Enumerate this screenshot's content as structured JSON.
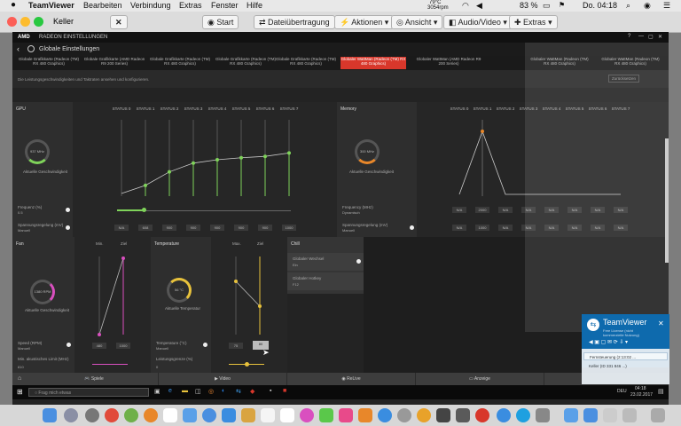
{
  "menubar": {
    "apple": "",
    "app": "TeamViewer",
    "items": [
      "Bearbeiten",
      "Verbindung",
      "Extras",
      "Fenster",
      "Hilfe"
    ],
    "temp": "79°C",
    "rpm": "3054rpm",
    "battery": "83 %",
    "clock": "Do. 04:18"
  },
  "tv": {
    "window_title": "Keller",
    "close": "✕",
    "buttons": [
      "Start",
      "Dateiübertragung",
      "Aktionen",
      "Ansicht",
      "Audio/Video",
      "Extras"
    ]
  },
  "amd": {
    "title": "RADEON EINSTELLUNGEN",
    "brand": "AMD",
    "back": "‹",
    "section": "Globale Einstellungen",
    "tabs": [
      "Globale Grafikkarte (Radeon (TM) RX 480 Graphics)",
      "Globale Grafikkarte (AMD Radeon R9 200 Series)",
      "Globale Grafikkarte (Radeon (TM) RX 480 Graphics)",
      "Globale Grafikkarte (Radeon (TM) RX 480 Graphics)",
      "Globale Grafikkarte (Radeon (TM) RX 480 Graphics)",
      "Globaler WattMan (Radeon (TM) RX 480 Graphics)",
      "Globaler WattMan (AMD Radeon R9 200 Series)",
      "Globaler WattMan (Radeon (TM) RX 480 Graphics)",
      "Globaler WattMan (Radeon (TM) RX 480 Graphics)"
    ],
    "description": "Die Leistungsgeschwindigkeiten und Taktraten ansehen und konfigurieren.",
    "reset_label": "Zurücksetzen",
    "gpu_label": "GPU",
    "memory_label": "Memory",
    "status_labels": [
      "STATUS 0",
      "STATUS 1",
      "STATUS 2",
      "STATUS 3",
      "STATUS 4",
      "STATUS 5",
      "STATUS 6",
      "STATUS 7"
    ],
    "gpu_gauge": "937 MHz",
    "gpu_gauge_caption": "Aktuelle Geschwindigkeit",
    "mem_gauge": "300 MHz",
    "mem_gauge_caption": "Aktuelle Geschwindigkeit",
    "freq_label": "Frequenz (%)",
    "freq_value": "0.5",
    "volt_label": "Spannungsregelung (mV)",
    "volt_mode": "Manuell",
    "gpu_cells": [
      "N/A",
      "608",
      "900",
      "900",
      "900",
      "900",
      "900",
      "1000"
    ],
    "mem_freq_label": "Frequency (MHz)",
    "mem_freq_mode": "Dynamisch",
    "mem_volt_label": "Spannungsregelung (mV)",
    "mem_volt_mode": "Manuell",
    "mem_cells1": [
      "N/A",
      "2000",
      "N/A",
      "N/A",
      "N/A",
      "N/A",
      "N/A",
      "N/A"
    ],
    "mem_cells2": [
      "N/A",
      "1000",
      "N/A",
      "N/A",
      "N/A",
      "N/A",
      "N/A",
      "N/A"
    ],
    "fan_label": "Fan",
    "fan_min": "Min.",
    "fan_ziel": "Ziel",
    "fan_gauge": "1380 RPM",
    "fan_gauge_caption": "Aktuelle Geschwindigkeit",
    "temp_label": "Temperature",
    "temp_max": "Max.",
    "temp_ziel": "Ziel",
    "temp_gauge": "56 °C",
    "temp_gauge_caption": "Aktuelle Temperatur",
    "chill_label": "Chill",
    "chill_items": [
      "Globaler Wechsel",
      "Globaler Hotkey"
    ],
    "chill_values": [
      "Ein",
      "F12"
    ],
    "speed_label": "Speed (RPM)",
    "speed_mode": "Manuell",
    "speed_values": [
      "480",
      "1000"
    ],
    "min_accoustic": "Min. akustisches Limit (MHz)",
    "min_accoustic_value": "810",
    "temp_c_label": "Temperature (°C)",
    "temp_c_mode": "Manuell",
    "temp_values": [
      "75",
      "80"
    ],
    "power_label": "Leistungsgrenze (%)",
    "power_value": "0",
    "bottom": [
      "Spiele",
      "Video",
      "ReLive",
      "Anzeige"
    ],
    "search_placeholder": "Frag mich etwas",
    "win_clock": "04:18",
    "win_date": "23.02.2017",
    "win_lang": "DEU"
  },
  "tvpanel": {
    "title": "TeamViewer",
    "line1": "Free License (nicht",
    "line2": "kommerzielle Nutzung)",
    "sessions": [
      "Fernsteuerung (2:13:02 ...",
      "Keller (ID 331 846 ...)"
    ]
  },
  "chart_data": [
    {
      "type": "line",
      "title": "GPU",
      "categories": [
        "STATUS 0",
        "STATUS 1",
        "STATUS 2",
        "STATUS 3",
        "STATUS 4",
        "STATUS 5",
        "STATUS 6",
        "STATUS 7"
      ],
      "values": [
        0,
        12,
        32,
        45,
        50,
        53,
        55,
        60
      ]
    },
    {
      "type": "line",
      "title": "Memory",
      "categories": [
        "STATUS 0",
        "STATUS 1",
        "STATUS 2",
        "STATUS 3",
        "STATUS 4",
        "STATUS 5",
        "STATUS 6",
        "STATUS 7"
      ],
      "values": [
        0,
        100,
        0,
        0,
        0,
        0,
        0,
        0
      ]
    }
  ],
  "colors": {
    "accent_red": "#d8372b",
    "gpu_line": "#7fd35a",
    "memory_line": "#e8872a",
    "fan_line": "#d94fbf",
    "temp_line": "#e8c23c",
    "tv_blue": "#0e6aad"
  }
}
